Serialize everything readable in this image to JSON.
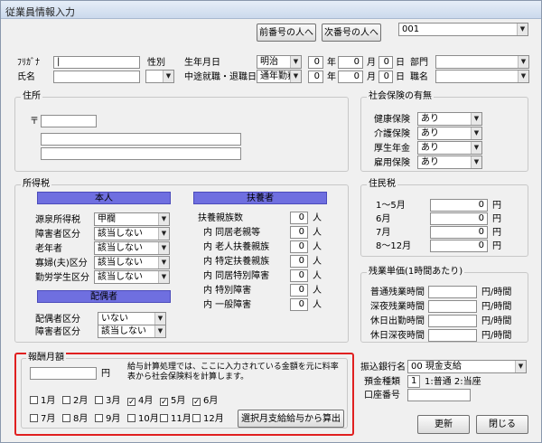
{
  "window": {
    "title": "従業員情報入力"
  },
  "toolbar": {
    "prev_label": "前番号の人へ",
    "next_label": "次番号の人へ",
    "employee_no": "001"
  },
  "personal": {
    "kana_label": "ﾌﾘｶﾞﾅ",
    "kana_value": "|",
    "name_label": "氏名",
    "name_value": "",
    "sex_label": "性別",
    "sex_value": "",
    "birth_label": "生年月日",
    "birth_era": "明治",
    "birth_y": "0",
    "birth_m": "0",
    "birth_d": "0",
    "unit_year": "年",
    "unit_month": "月",
    "unit_day": "日",
    "hire_label": "中途就職・退職日",
    "hire_type": "通年勤務",
    "hire_y": "0",
    "hire_m": "0",
    "hire_d": "0",
    "dept_label": "部門",
    "dept_value": "",
    "title_label": "職名",
    "title_value": ""
  },
  "address": {
    "group_title": "住所",
    "postal_mark": "〒",
    "postal": "",
    "line1": "",
    "line2": ""
  },
  "social": {
    "group_title": "社会保険の有無",
    "items": [
      {
        "label": "健康保険",
        "value": "あり"
      },
      {
        "label": "介護保険",
        "value": "あり"
      },
      {
        "label": "厚生年金",
        "value": "あり"
      },
      {
        "label": "雇用保険",
        "value": "あり"
      }
    ]
  },
  "income_tax": {
    "group_title": "所得税",
    "self_header": "本人",
    "self_items": [
      {
        "label": "源泉所得税",
        "value": "甲欄"
      },
      {
        "label": "障害者区分",
        "value": "該当しない"
      },
      {
        "label": "老年者",
        "value": "該当しない"
      },
      {
        "label": "寡婦(夫)区分",
        "value": "該当しない"
      },
      {
        "label": "勤労学生区分",
        "value": "該当しない"
      }
    ],
    "spouse_header": "配偶者",
    "spouse_items": [
      {
        "label": "配偶者区分",
        "value": "いない"
      },
      {
        "label": "障害者区分",
        "value": "該当しない"
      }
    ],
    "dependents_header": "扶養者",
    "person_unit": "人",
    "dependents": [
      {
        "label": "扶養親族数",
        "value": "0"
      },
      {
        "label": "内 同居老親等",
        "value": "0"
      },
      {
        "label": "内 老人扶養親族",
        "value": "0"
      },
      {
        "label": "内 特定扶養親族",
        "value": "0"
      },
      {
        "label": "内 同居特別障害",
        "value": "0"
      },
      {
        "label": "内 特別障害",
        "value": "0"
      },
      {
        "label": "内 一般障害",
        "value": "0"
      }
    ]
  },
  "resident_tax": {
    "group_title": "住民税",
    "unit": "円",
    "items": [
      {
        "label": "1～5月",
        "value": "0"
      },
      {
        "label": "6月",
        "value": "0"
      },
      {
        "label": "7月",
        "value": "0"
      },
      {
        "label": "8～12月",
        "value": "0"
      }
    ]
  },
  "overtime": {
    "group_title": "残業単価(1時間あたり)",
    "unit": "円/時間",
    "items": [
      {
        "label": "普通残業時間",
        "value": ""
      },
      {
        "label": "深夜残業時間",
        "value": ""
      },
      {
        "label": "休日出勤時間",
        "value": ""
      },
      {
        "label": "休日深夜時間",
        "value": ""
      }
    ]
  },
  "salary": {
    "group_title": "報酬月額",
    "amount": "",
    "unit": "円",
    "note": "給与計算処理では、ここに入力されている金額を元に料率表から社会保険料を計算します。",
    "months": [
      {
        "label": "1月",
        "checked": false
      },
      {
        "label": "2月",
        "checked": false
      },
      {
        "label": "3月",
        "checked": false
      },
      {
        "label": "4月",
        "checked": true
      },
      {
        "label": "5月",
        "checked": true
      },
      {
        "label": "6月",
        "checked": true
      },
      {
        "label": "7月",
        "checked": false
      },
      {
        "label": "8月",
        "checked": false
      },
      {
        "label": "9月",
        "checked": false
      },
      {
        "label": "10月",
        "checked": false
      },
      {
        "label": "11月",
        "checked": false
      },
      {
        "label": "12月",
        "checked": false
      }
    ],
    "calc_label": "選択月支給給与から算出",
    "highlight_color": "#e02020"
  },
  "bank": {
    "bank_label": "振込銀行名",
    "bank_value": "00 現金支給",
    "type_label": "預金種類",
    "type_value": "1",
    "type_hint": "1:普通 2:当座",
    "account_label": "口座番号",
    "account_value": ""
  },
  "actions": {
    "update_label": "更新",
    "close_label": "閉じる"
  },
  "colors": {
    "band": "#6f6fe0",
    "highlight": "#e02020"
  }
}
